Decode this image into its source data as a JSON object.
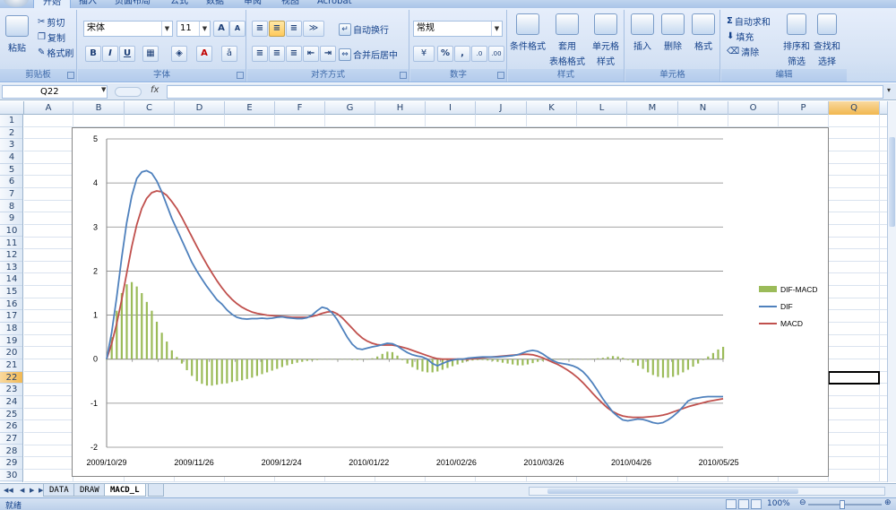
{
  "ribbon": {
    "tabs": [
      "开始",
      "插入",
      "页面布局",
      "公式",
      "数据",
      "审阅",
      "视图",
      "Acrobat"
    ],
    "clipboard": {
      "paste": "粘贴",
      "cut": "剪切",
      "copy": "复制",
      "format_painter": "格式刷",
      "label": "剪贴板"
    },
    "font": {
      "name": "宋体",
      "size": "11",
      "bold": "B",
      "italic": "I",
      "underline": "U",
      "label": "字体"
    },
    "alignment": {
      "wrap_text": "自动换行",
      "merge_center": "合并后居中",
      "label": "对齐方式"
    },
    "number": {
      "format": "常规",
      "percent": "%",
      "comma": ",",
      "label": "数字"
    },
    "styles": {
      "conditional": "条件格式",
      "table_fmt_1": "套用",
      "table_fmt_2": "表格格式",
      "cell_style_1": "单元格",
      "cell_style_2": "样式",
      "label": "样式"
    },
    "cells": {
      "insert": "插入",
      "delete": "删除",
      "format": "格式",
      "label": "单元格"
    },
    "editing": {
      "autosum": "自动求和",
      "fill": "填充",
      "clear": "清除",
      "sort_filter_1": "排序和",
      "sort_filter_2": "筛选",
      "find_select_1": "查找和",
      "find_select_2": "选择",
      "label": "编辑"
    }
  },
  "formula_bar": {
    "name_box": "Q22",
    "fx": "fx",
    "value": ""
  },
  "columns": [
    "A",
    "B",
    "C",
    "D",
    "E",
    "F",
    "G",
    "H",
    "I",
    "J",
    "K",
    "L",
    "M",
    "N",
    "O",
    "P",
    "Q"
  ],
  "rows": [
    "1",
    "2",
    "3",
    "4",
    "5",
    "6",
    "7",
    "8",
    "9",
    "10",
    "11",
    "12",
    "13",
    "14",
    "15",
    "16",
    "17",
    "18",
    "19",
    "20",
    "21",
    "22",
    "23",
    "24",
    "25",
    "26",
    "27",
    "28",
    "29",
    "30"
  ],
  "selected": {
    "column": "Q",
    "row": "22"
  },
  "sheet_tabs": [
    "DATA",
    "DRAW",
    "MACD_L"
  ],
  "active_sheet": "MACD_L",
  "status": {
    "ready": "就绪",
    "zoom": "100%"
  },
  "colors": {
    "dif": "#4f81bd",
    "macd": "#c0504d",
    "bar": "#9bbb59",
    "accent": "#f1b74f"
  },
  "chart_data": {
    "type": "line",
    "title": "",
    "xlabel": "",
    "ylabel": "",
    "ylim": [
      -2,
      5
    ],
    "y_ticks": [
      "5",
      "4",
      "3",
      "2",
      "1",
      "0",
      "-1",
      "-2"
    ],
    "x_tick_labels": [
      "2009/10/29",
      "2009/11/26",
      "2009/12/24",
      "2010/01/22",
      "2010/02/26",
      "2010/03/26",
      "2010/04/26",
      "2010/05/25"
    ],
    "grid": true,
    "legend_position": "right",
    "series": [
      {
        "name": "DIF-MACD",
        "kind": "bar",
        "values": [
          0.0,
          0.5,
          1.1,
          1.5,
          1.7,
          1.75,
          1.65,
          1.5,
          1.3,
          1.1,
          0.85,
          0.6,
          0.4,
          0.2,
          0.05,
          -0.1,
          -0.25,
          -0.38,
          -0.5,
          -0.56,
          -0.6,
          -0.6,
          -0.58,
          -0.56,
          -0.55,
          -0.52,
          -0.5,
          -0.48,
          -0.45,
          -0.42,
          -0.38,
          -0.34,
          -0.3,
          -0.26,
          -0.22,
          -0.18,
          -0.14,
          -0.11,
          -0.08,
          -0.06,
          -0.04,
          -0.03,
          -0.02,
          -0.01,
          -0.01,
          0.0,
          0.0,
          0.0,
          -0.01,
          -0.02,
          -0.02,
          -0.01,
          0.0,
          0.02,
          0.06,
          0.12,
          0.17,
          0.16,
          0.08,
          -0.02,
          -0.1,
          -0.18,
          -0.24,
          -0.28,
          -0.3,
          -0.3,
          -0.28,
          -0.24,
          -0.2,
          -0.16,
          -0.12,
          -0.08,
          -0.05,
          -0.03,
          -0.02,
          -0.02,
          -0.03,
          -0.04,
          -0.06,
          -0.08,
          -0.1,
          -0.12,
          -0.14,
          -0.14,
          -0.12,
          -0.09,
          -0.06,
          -0.04,
          -0.03,
          -0.02,
          -0.01,
          0.0,
          0.0,
          0.01,
          0.01,
          0.0,
          0.0,
          0.01,
          0.02,
          0.03,
          0.05,
          0.07,
          0.06,
          0.03,
          -0.02,
          -0.08,
          -0.15,
          -0.22,
          -0.3,
          -0.36,
          -0.4,
          -0.42,
          -0.42,
          -0.4,
          -0.36,
          -0.3,
          -0.24,
          -0.17,
          -0.1,
          -0.02,
          0.06,
          0.14,
          0.22,
          0.28
        ]
      },
      {
        "name": "DIF",
        "kind": "line",
        "x": [
          0,
          1,
          2,
          3,
          4,
          5,
          6,
          7,
          8,
          9,
          10,
          11,
          12,
          13,
          14,
          15,
          16,
          17,
          18,
          19,
          20,
          21,
          22,
          23,
          24,
          25,
          26,
          27,
          28,
          29,
          30,
          31,
          32,
          33,
          34,
          35,
          36,
          37,
          38,
          39,
          40,
          41,
          42,
          43,
          44,
          45,
          46,
          47,
          48,
          49,
          50,
          51,
          52,
          53,
          54,
          55,
          56,
          57,
          58,
          59,
          60,
          61,
          62,
          63,
          64,
          65,
          66,
          67,
          68,
          69,
          70,
          71,
          72,
          73,
          74,
          75,
          76,
          77,
          78,
          79,
          80,
          81,
          82,
          83,
          84,
          85,
          86,
          87,
          88,
          89,
          90,
          91,
          92,
          93,
          94,
          95,
          96,
          97,
          98,
          99,
          100,
          101,
          102,
          103,
          104,
          105,
          106,
          107,
          108,
          109,
          110,
          111,
          112,
          113,
          114,
          115,
          116,
          117,
          118,
          119,
          120,
          121,
          122,
          123
        ],
        "values": [
          0.0,
          0.6,
          1.4,
          2.3,
          3.1,
          3.7,
          4.1,
          4.25,
          4.28,
          4.22,
          4.05,
          3.8,
          3.5,
          3.2,
          2.95,
          2.7,
          2.45,
          2.2,
          2.0,
          1.82,
          1.65,
          1.5,
          1.35,
          1.25,
          1.12,
          1.02,
          0.95,
          0.92,
          0.91,
          0.92,
          0.92,
          0.93,
          0.92,
          0.93,
          0.95,
          0.96,
          0.94,
          0.93,
          0.92,
          0.92,
          0.94,
          1.0,
          1.1,
          1.18,
          1.15,
          1.05,
          0.9,
          0.7,
          0.5,
          0.34,
          0.24,
          0.22,
          0.25,
          0.28,
          0.3,
          0.33,
          0.36,
          0.35,
          0.3,
          0.22,
          0.15,
          0.1,
          0.07,
          0.05,
          0.0,
          -0.1,
          -0.15,
          -0.1,
          -0.05,
          -0.02,
          0.0,
          0.0,
          0.02,
          0.03,
          0.04,
          0.05,
          0.05,
          0.05,
          0.05,
          0.06,
          0.07,
          0.08,
          0.1,
          0.14,
          0.18,
          0.2,
          0.18,
          0.12,
          0.04,
          -0.03,
          -0.08,
          -0.1,
          -0.12,
          -0.15,
          -0.2,
          -0.28,
          -0.4,
          -0.55,
          -0.72,
          -0.9,
          -1.05,
          -1.2,
          -1.3,
          -1.38,
          -1.4,
          -1.38,
          -1.36,
          -1.37,
          -1.4,
          -1.44,
          -1.46,
          -1.44,
          -1.38,
          -1.3,
          -1.2,
          -1.08,
          -0.95,
          -0.9,
          -0.88,
          -0.86,
          -0.85,
          -0.85,
          -0.85,
          -0.85
        ]
      },
      {
        "name": "MACD",
        "kind": "line",
        "x": [
          0,
          1,
          2,
          3,
          4,
          5,
          6,
          7,
          8,
          9,
          10,
          11,
          12,
          13,
          14,
          15,
          16,
          17,
          18,
          19,
          20,
          21,
          22,
          23,
          24,
          25,
          26,
          27,
          28,
          29,
          30,
          31,
          32,
          33,
          34,
          35,
          36,
          37,
          38,
          39,
          40,
          41,
          42,
          43,
          44,
          45,
          46,
          47,
          48,
          49,
          50,
          51,
          52,
          53,
          54,
          55,
          56,
          57,
          58,
          59,
          60,
          61,
          62,
          63,
          64,
          65,
          66,
          67,
          68,
          69,
          70,
          71,
          72,
          73,
          74,
          75,
          76,
          77,
          78,
          79,
          80,
          81,
          82,
          83,
          84,
          85,
          86,
          87,
          88,
          89,
          90,
          91,
          92,
          93,
          94,
          95,
          96,
          97,
          98,
          99,
          100,
          101,
          102,
          103,
          104,
          105,
          106,
          107,
          108,
          109,
          110,
          111,
          112,
          113,
          114,
          115,
          116,
          117,
          118,
          119,
          120,
          121,
          122,
          123
        ],
        "values": [
          0.0,
          0.35,
          0.8,
          1.35,
          1.95,
          2.55,
          3.05,
          3.42,
          3.65,
          3.78,
          3.82,
          3.8,
          3.72,
          3.58,
          3.42,
          3.22,
          3.0,
          2.78,
          2.56,
          2.35,
          2.15,
          1.96,
          1.78,
          1.62,
          1.48,
          1.36,
          1.26,
          1.18,
          1.12,
          1.07,
          1.04,
          1.02,
          1.0,
          0.99,
          0.98,
          0.97,
          0.96,
          0.95,
          0.95,
          0.95,
          0.95,
          0.97,
          1.0,
          1.04,
          1.07,
          1.08,
          1.03,
          0.94,
          0.82,
          0.7,
          0.58,
          0.48,
          0.41,
          0.36,
          0.33,
          0.32,
          0.32,
          0.32,
          0.3,
          0.27,
          0.24,
          0.2,
          0.16,
          0.12,
          0.08,
          0.04,
          0.01,
          0.0,
          0.0,
          0.0,
          0.0,
          0.0,
          0.0,
          0.01,
          0.02,
          0.03,
          0.04,
          0.05,
          0.06,
          0.07,
          0.08,
          0.09,
          0.1,
          0.11,
          0.11,
          0.1,
          0.07,
          0.03,
          -0.02,
          -0.07,
          -0.12,
          -0.18,
          -0.25,
          -0.33,
          -0.42,
          -0.53,
          -0.65,
          -0.78,
          -0.9,
          -1.01,
          -1.11,
          -1.19,
          -1.25,
          -1.29,
          -1.31,
          -1.32,
          -1.32,
          -1.32,
          -1.31,
          -1.3,
          -1.29,
          -1.27,
          -1.24,
          -1.2,
          -1.16,
          -1.12,
          -1.08,
          -1.05,
          -1.02,
          -0.99,
          -0.96,
          -0.94,
          -0.92,
          -0.9
        ]
      }
    ]
  }
}
